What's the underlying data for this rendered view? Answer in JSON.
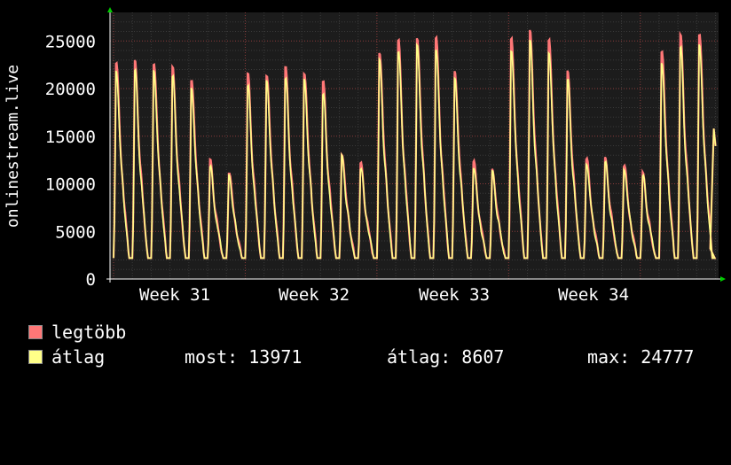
{
  "chart_data": {
    "type": "line",
    "ylabel": "onlinestream.live",
    "ylim": [
      0,
      28000
    ],
    "yticks": [
      0,
      5000,
      10000,
      15000,
      20000,
      25000
    ],
    "weeks": [
      "Week 31",
      "Week 32",
      "Week 33",
      "Week 34"
    ],
    "series": [
      {
        "name": "legtöbb",
        "color": "#ff7777",
        "daily_peaks": [
          22800,
          22700,
          22700,
          22000,
          21000,
          12300,
          11300,
          21300,
          21500,
          22000,
          21700,
          20500,
          13200,
          12000,
          23800,
          24900,
          25300,
          25200,
          21800,
          12300,
          11500,
          25200,
          26000,
          25100,
          21700,
          12700,
          12600,
          12000,
          11000,
          24000,
          25400,
          25800
        ]
      },
      {
        "name": "átlag",
        "color": "#ffff88",
        "daily_peaks": [
          21900,
          21800,
          21900,
          21200,
          20000,
          11800,
          10900,
          20300,
          20700,
          21100,
          20800,
          19500,
          12800,
          11700,
          22800,
          24000,
          24300,
          24200,
          20800,
          11800,
          11100,
          24100,
          24777,
          23900,
          20700,
          12200,
          12100,
          11600,
          10700,
          22700,
          24200,
          24600
        ]
      }
    ],
    "night_minimum_approx": 2200,
    "current_value": 13971
  },
  "legend": {
    "max_label": "legtöbb",
    "avg_label": "átlag",
    "max_color": "#ff7777",
    "avg_color": "#ffff88"
  },
  "stats": {
    "most": "most: 13971",
    "atlag": "átlag: 8607",
    "max": "max: 24777"
  }
}
